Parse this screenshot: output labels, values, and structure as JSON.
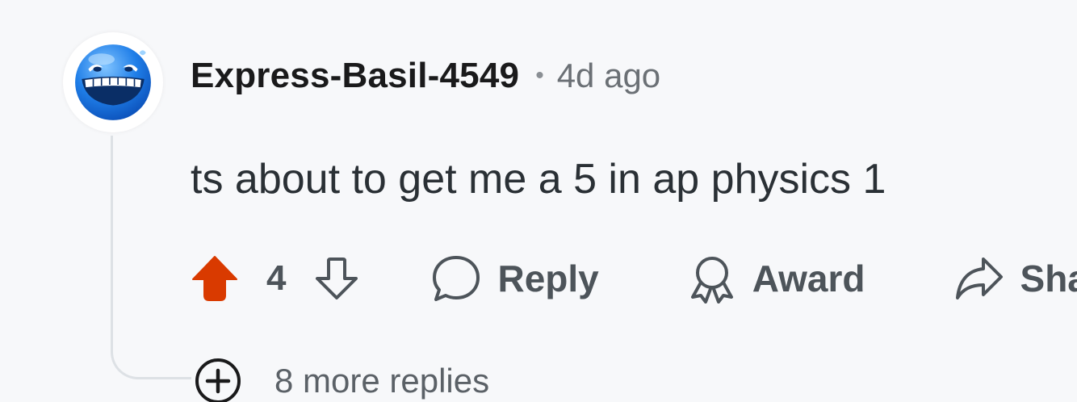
{
  "comment": {
    "username": "Express-Basil-4549",
    "separator": "•",
    "time": "4d ago",
    "body": "ts about to get me a 5 in ap physics 1",
    "avatar_icon": "laughing-blue-face-avatar"
  },
  "actions": {
    "score": "4",
    "upvote_icon": "upvote-arrow-icon",
    "downvote_icon": "downvote-arrow-icon",
    "reply_label": "Reply",
    "award_label": "Award",
    "share_label": "Sha"
  },
  "thread": {
    "more_replies_label": "8 more replies",
    "expand_icon": "plus-circle-icon"
  },
  "colors": {
    "upvote_active": "#d93a00",
    "text_primary": "#1a1a1b",
    "text_secondary": "#6b7075",
    "icon_gray": "#4d545a",
    "background": "#f7f8fa",
    "thread_line": "#dde1e5"
  }
}
